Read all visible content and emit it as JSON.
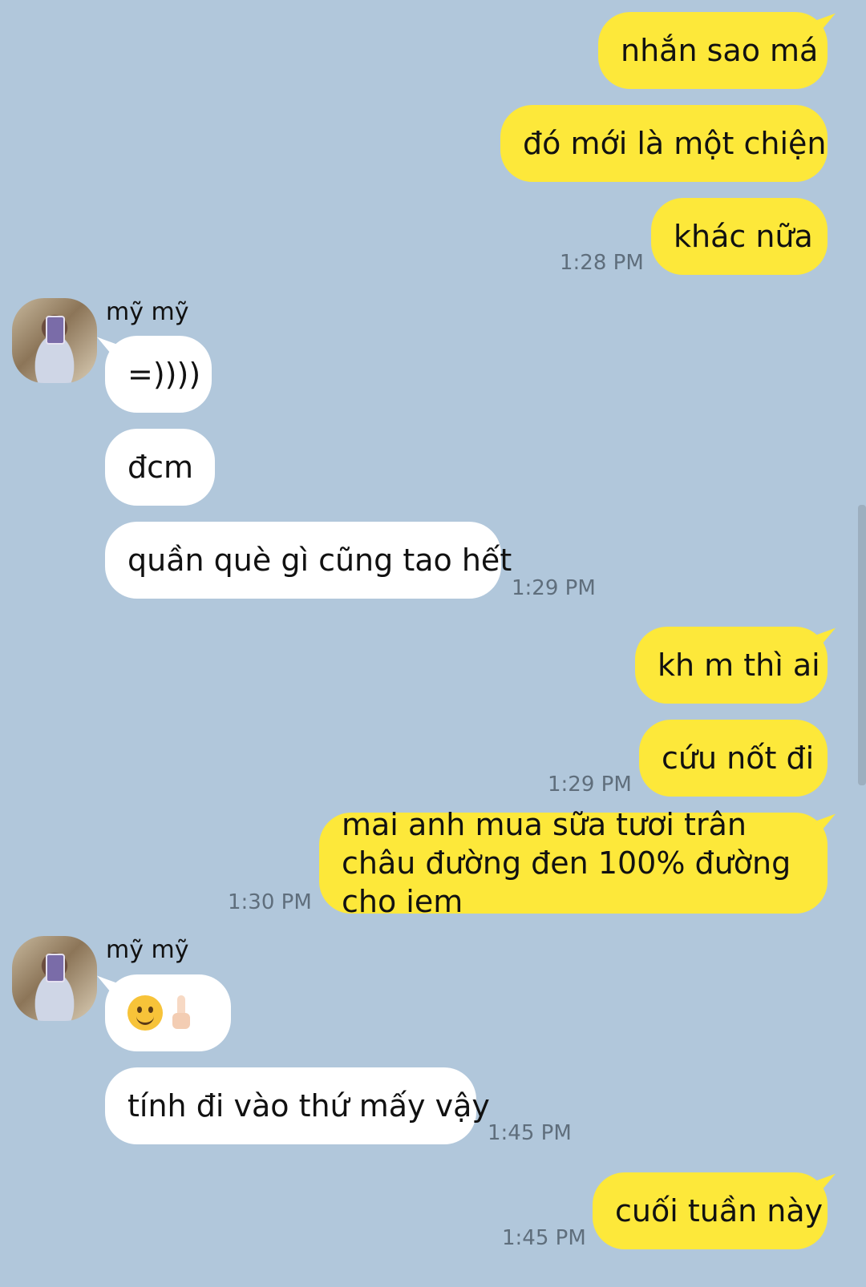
{
  "contact": {
    "name": "mỹ mỹ"
  },
  "messages": [
    {
      "id": "m1",
      "dir": "out",
      "text": "nhắn sao má"
    },
    {
      "id": "m2",
      "dir": "out",
      "text": "đó mới là một chiện"
    },
    {
      "id": "m3",
      "dir": "out",
      "text": "khác nữa",
      "time": "1:28 PM"
    },
    {
      "id": "m4",
      "dir": "in",
      "text": "=))))"
    },
    {
      "id": "m5",
      "dir": "in",
      "text": "đcm"
    },
    {
      "id": "m6",
      "dir": "in",
      "text": "quần què gì cũng tao hết",
      "time": "1:29 PM"
    },
    {
      "id": "m7",
      "dir": "out",
      "text": "kh m thì ai"
    },
    {
      "id": "m8",
      "dir": "out",
      "text": "cứu nốt đi",
      "time": "1:29 PM"
    },
    {
      "id": "m9",
      "dir": "out",
      "text": "mai anh mua sữa tươi trân châu đường đen 100% đường cho iem",
      "time": "1:30 PM"
    },
    {
      "id": "m10",
      "dir": "in",
      "emoji": [
        "slightly-smiling-face",
        "middle-finger"
      ]
    },
    {
      "id": "m11",
      "dir": "in",
      "text": "tính đi vào thứ mấy vậy",
      "time": "1:45 PM"
    },
    {
      "id": "m12",
      "dir": "out",
      "text": "cuối tuần này",
      "time": "1:45 PM"
    }
  ],
  "colors": {
    "background": "#b1c7db",
    "outgoing": "#fde83a",
    "incoming": "#ffffff",
    "timestamp": "#5f6e7c"
  }
}
